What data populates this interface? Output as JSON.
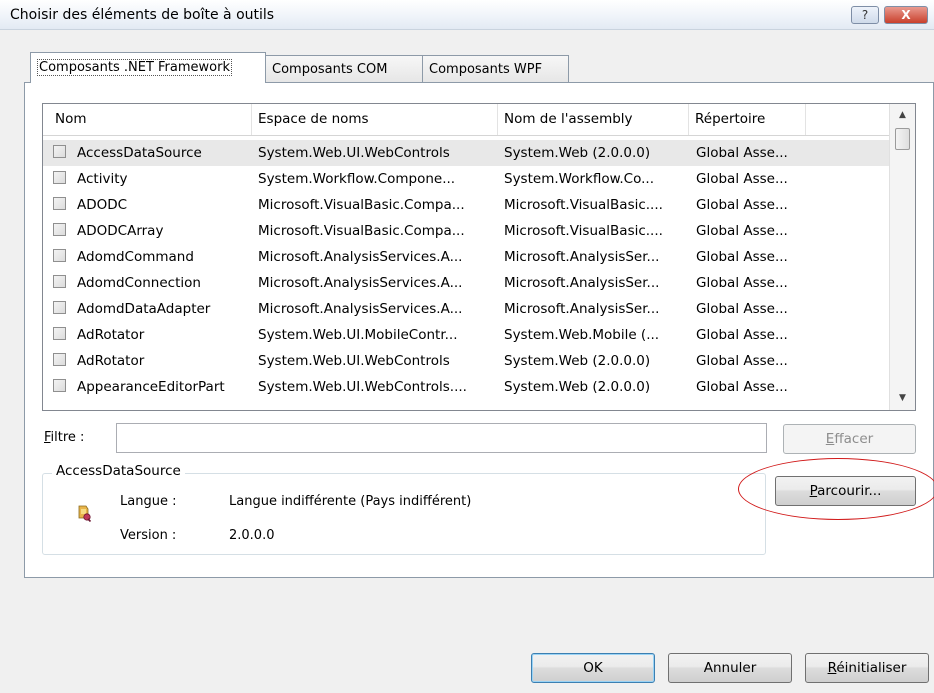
{
  "window": {
    "title": "Choisir des éléments de boîte à outils",
    "help_label": "?",
    "close_label": "X"
  },
  "tabs": [
    {
      "label": "Composants .NET Framework"
    },
    {
      "label": "Composants COM"
    },
    {
      "label": "Composants WPF"
    }
  ],
  "list": {
    "columns": [
      "Nom",
      "Espace de noms",
      "Nom de l'assembly",
      "Répertoire"
    ],
    "rows": [
      {
        "name": "AccessDataSource",
        "namespace": "System.Web.UI.WebControls",
        "assembly": "System.Web (2.0.0.0)",
        "directory": "Global Asse..."
      },
      {
        "name": "Activity",
        "namespace": "System.Workflow.Compone...",
        "assembly": "System.Workflow.Co...",
        "directory": "Global Asse..."
      },
      {
        "name": "ADODC",
        "namespace": "Microsoft.VisualBasic.Compa...",
        "assembly": "Microsoft.VisualBasic....",
        "directory": "Global Asse..."
      },
      {
        "name": "ADODCArray",
        "namespace": "Microsoft.VisualBasic.Compa...",
        "assembly": "Microsoft.VisualBasic....",
        "directory": "Global Asse..."
      },
      {
        "name": "AdomdCommand",
        "namespace": "Microsoft.AnalysisServices.A...",
        "assembly": "Microsoft.AnalysisSer...",
        "directory": "Global Asse..."
      },
      {
        "name": "AdomdConnection",
        "namespace": "Microsoft.AnalysisServices.A...",
        "assembly": "Microsoft.AnalysisSer...",
        "directory": "Global Asse..."
      },
      {
        "name": "AdomdDataAdapter",
        "namespace": "Microsoft.AnalysisServices.A...",
        "assembly": "Microsoft.AnalysisSer...",
        "directory": "Global Asse..."
      },
      {
        "name": "AdRotator",
        "namespace": "System.Web.UI.MobileContr...",
        "assembly": "System.Web.Mobile (...",
        "directory": "Global Asse..."
      },
      {
        "name": "AdRotator",
        "namespace": "System.Web.UI.WebControls",
        "assembly": "System.Web (2.0.0.0)",
        "directory": "Global Asse..."
      },
      {
        "name": "AppearanceEditorPart",
        "namespace": "System.Web.UI.WebControls....",
        "assembly": "System.Web (2.0.0.0)",
        "directory": "Global Asse..."
      }
    ]
  },
  "filter": {
    "label_underlined": "F",
    "label_rest": "iltre :",
    "value": "",
    "clear_underlined": "E",
    "clear_rest": "ffacer"
  },
  "details": {
    "legend": "AccessDataSource",
    "language_label": "Langue :",
    "language_value": "Langue indifférente (Pays indifférent)",
    "version_label": "Version :",
    "version_value": "2.0.0.0"
  },
  "browse": {
    "underlined": "P",
    "rest": "arcourir..."
  },
  "buttons": {
    "ok": "OK",
    "cancel": "Annuler",
    "reset_underlined": "R",
    "reset_rest": "éinitialiser"
  },
  "colors": {
    "annotation_ellipse": "#d11a1a",
    "selected_row": "#e8e8e8"
  }
}
